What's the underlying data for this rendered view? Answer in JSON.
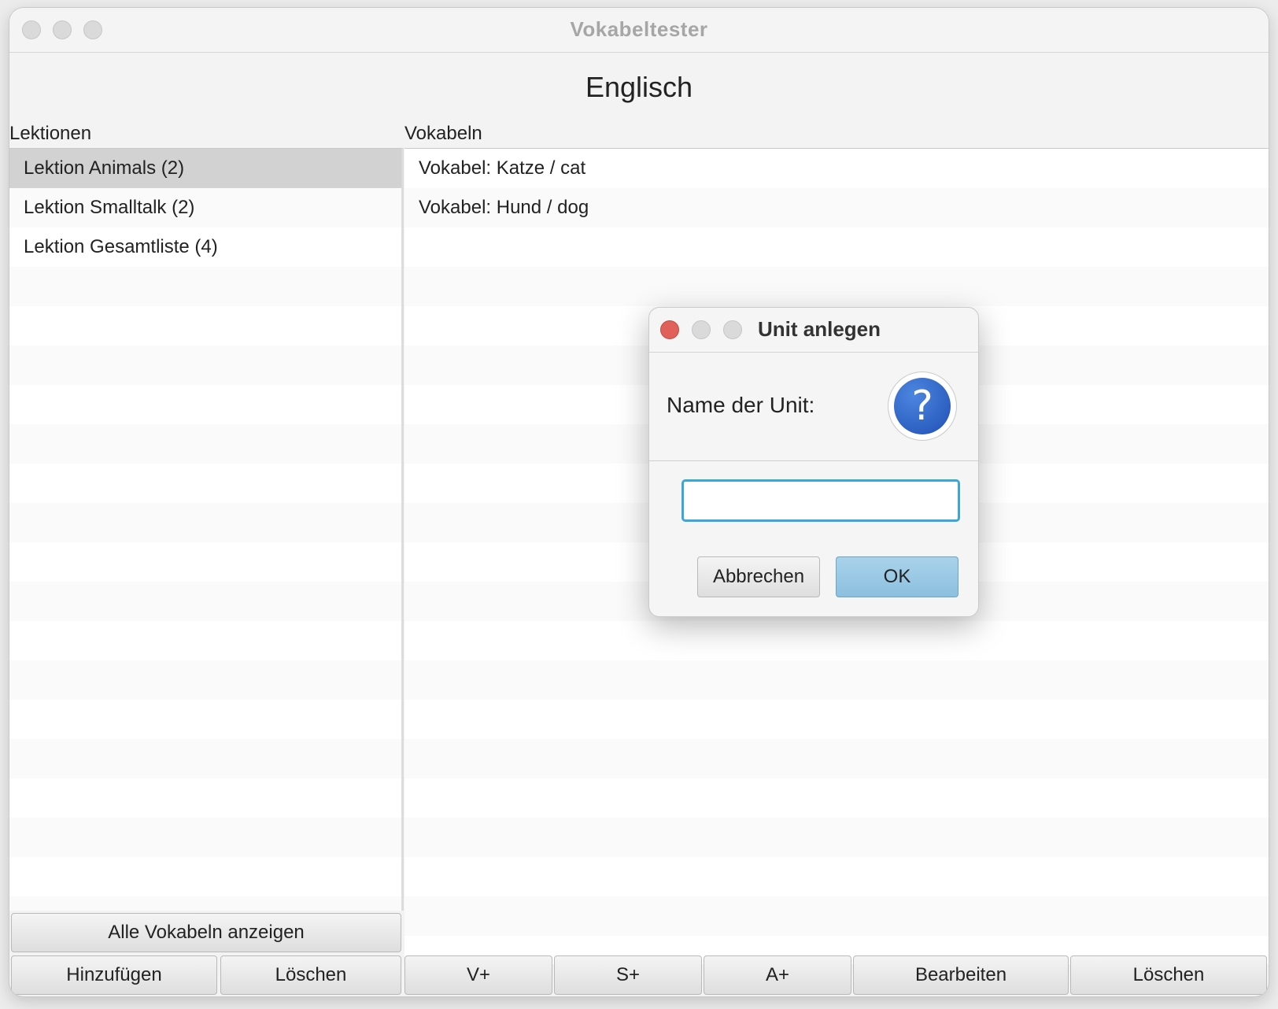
{
  "window": {
    "title": "Vokabeltester"
  },
  "main": {
    "heading": "Englisch",
    "lessons_label": "Lektionen",
    "vocab_label": "Vokabeln"
  },
  "lessons": [
    {
      "label": "Lektion Animals (2)",
      "selected": true
    },
    {
      "label": "Lektion Smalltalk (2)",
      "selected": false
    },
    {
      "label": "Lektion Gesamtliste (4)",
      "selected": false
    }
  ],
  "vocabs": [
    {
      "label": "Vokabel: Katze / cat"
    },
    {
      "label": "Vokabel: Hund / dog"
    }
  ],
  "left_buttons": {
    "show_all": "Alle Vokabeln anzeigen",
    "add": "Hinzufügen",
    "delete": "Löschen"
  },
  "right_buttons": {
    "v_plus": "V+",
    "s_plus": "S+",
    "a_plus": "A+",
    "edit": "Bearbeiten",
    "delete": "Löschen"
  },
  "dialog": {
    "title": "Unit anlegen",
    "prompt": "Name der Unit:",
    "input_value": "",
    "cancel": "Abbrechen",
    "ok": "OK",
    "icon": "question-icon"
  },
  "colors": {
    "close_red": "#e0605a",
    "ok_blue": "#9ccbe6",
    "focus_ring": "#3aa6d9",
    "selection": "#d2d2d2"
  }
}
